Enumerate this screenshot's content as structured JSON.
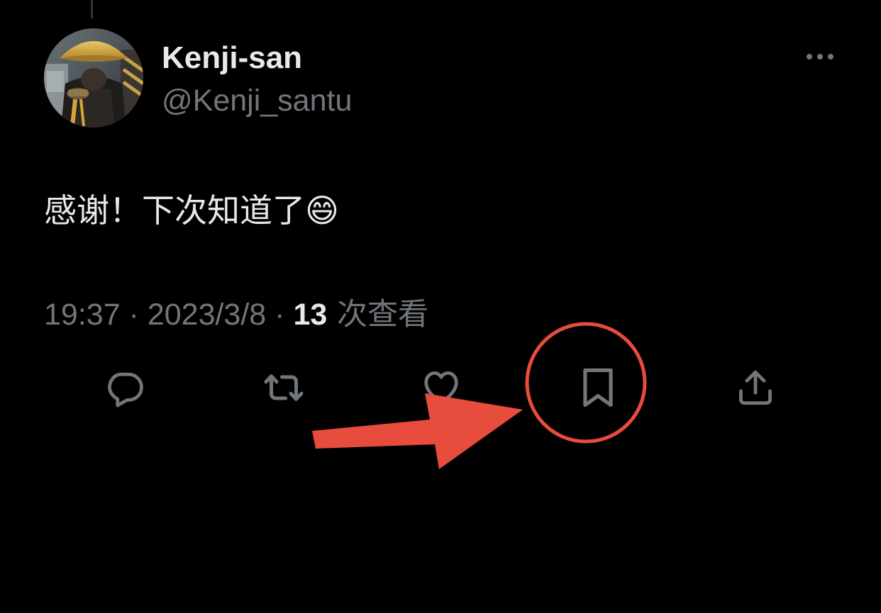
{
  "tweet": {
    "author": {
      "display_name": "Kenji-san",
      "handle": "@Kenji_santu",
      "avatar_icon": "avatar-photo-monk-straw-hat"
    },
    "text": "感谢！下次知道了😄",
    "meta": {
      "time": "19:37",
      "separator": " · ",
      "date": "2023/3/8",
      "views_count": "13",
      "views_label": " 次查看"
    },
    "actions": [
      {
        "name": "reply",
        "icon": "reply-icon"
      },
      {
        "name": "retweet",
        "icon": "retweet-icon"
      },
      {
        "name": "like",
        "icon": "heart-icon"
      },
      {
        "name": "bookmark",
        "icon": "bookmark-icon"
      },
      {
        "name": "share",
        "icon": "share-icon"
      }
    ],
    "more_icon": "more-horizontal-icon"
  },
  "annotation": {
    "color": "#e84c3d",
    "shapes": [
      "circle-highlight",
      "arrow"
    ],
    "target": "bookmark"
  },
  "colors": {
    "background": "#000000",
    "primary_text": "#e7e9ea",
    "secondary_text": "#71767b",
    "annotation": "#e84c3d"
  }
}
